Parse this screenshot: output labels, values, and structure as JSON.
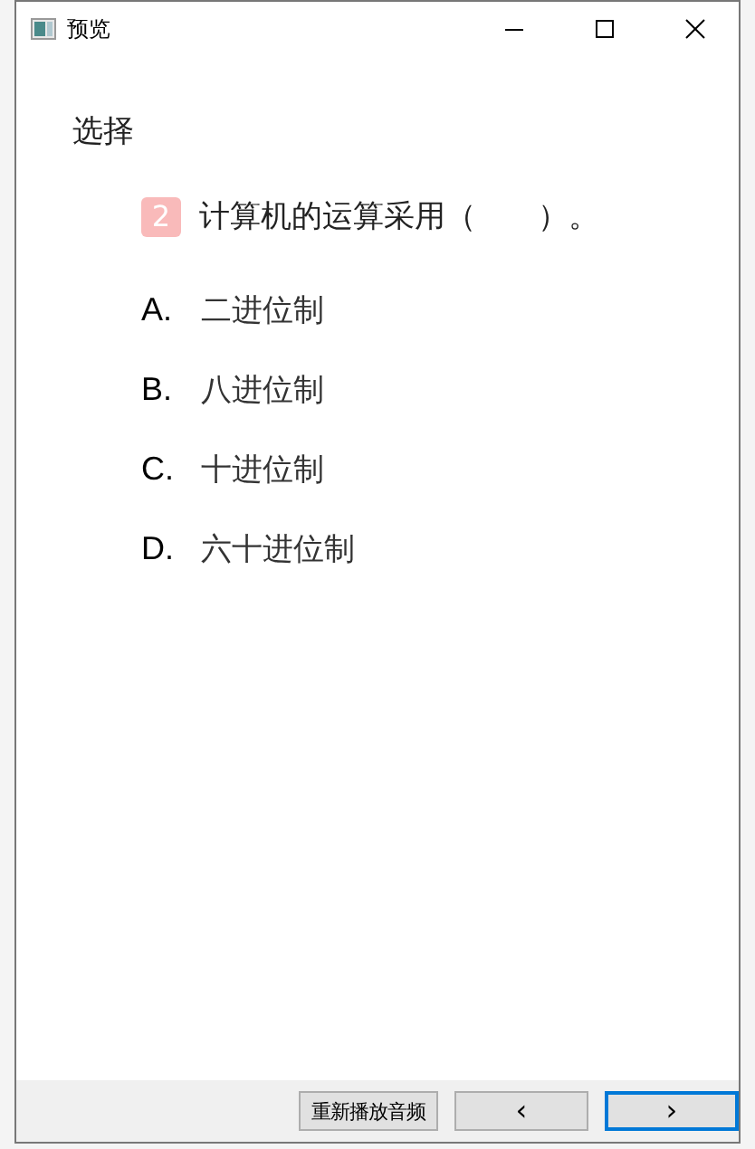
{
  "window": {
    "title": "预览"
  },
  "section_title": "选择",
  "question": {
    "number": "2",
    "text": "计算机的运算采用（　　）。"
  },
  "options": [
    {
      "letter": "A.",
      "text": "二进位制"
    },
    {
      "letter": "B.",
      "text": "八进位制"
    },
    {
      "letter": "C.",
      "text": "十进位制"
    },
    {
      "letter": "D.",
      "text": "六十进位制"
    }
  ],
  "buttons": [
    {
      "label": "重新播放音频",
      "kind": "text",
      "focused": false
    },
    {
      "label": "‹",
      "kind": "nav",
      "focused": false
    },
    {
      "label": "›",
      "kind": "nav",
      "focused": true
    }
  ]
}
